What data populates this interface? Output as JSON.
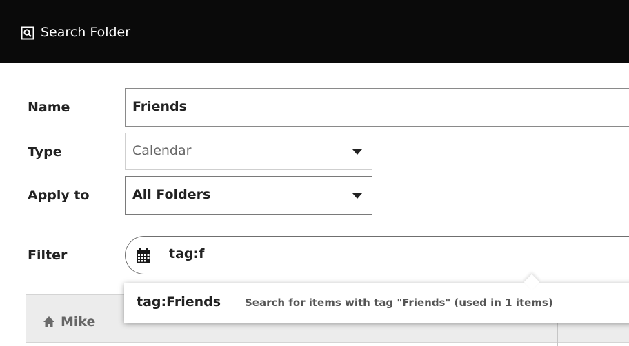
{
  "dialog": {
    "title": "Search Folder",
    "title_icon": "search-folder-icon"
  },
  "form": {
    "name_label": "Name",
    "name_value": "Friends",
    "type_label": "Type",
    "type_value": "Calendar",
    "apply_label": "Apply to",
    "apply_value": "All Folders",
    "filter_label": "Filter",
    "filter_value": "tag:f",
    "filter_icon": "calendar-icon"
  },
  "suggestion": {
    "value": "tag:Friends",
    "description": "Search for items with tag \"Friends\" (used in 1 items)"
  },
  "tree": {
    "root_label": "Mike",
    "root_icon": "home-icon"
  },
  "colors": {
    "titlebar_bg": "#0a0a0a",
    "panel_bg": "#ececec"
  }
}
